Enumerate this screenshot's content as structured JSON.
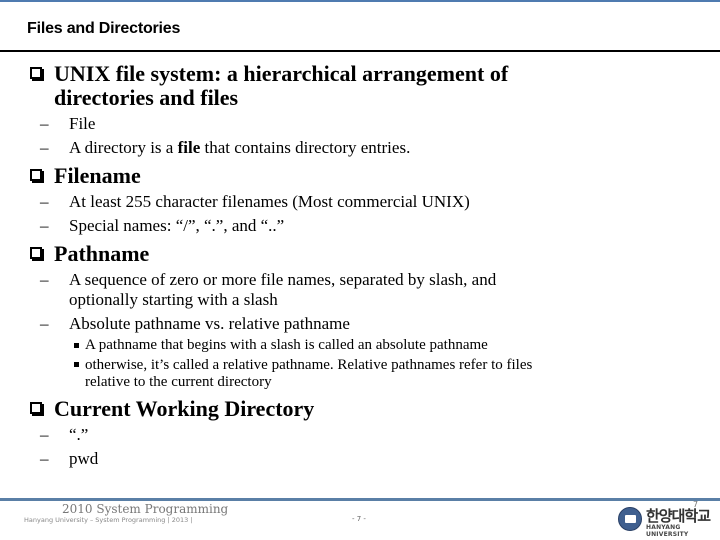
{
  "header": {
    "title": "Files and Directories",
    "accent_color": "#4f7bb0"
  },
  "sections": [
    {
      "heading": "UNIX file system: a hierarchical arrangement of directories and files",
      "heading_line1": "UNIX file system: a hierarchical arrangement of",
      "heading_line2": "directories and files",
      "items": [
        {
          "text": "File"
        },
        {
          "pre": "A directory is a ",
          "bold": "file",
          "post": " that contains directory entries."
        }
      ]
    },
    {
      "heading": "Filename",
      "items": [
        {
          "text": "At least 255 character filenames (Most commercial UNIX)"
        },
        {
          "text": "Special names: “/”, “.”, and “..”"
        }
      ]
    },
    {
      "heading": "Pathname",
      "items": [
        {
          "line1": "A sequence of zero or more file names, separated by slash, and",
          "line2": "optionally starting with a slash"
        },
        {
          "text": "Absolute pathname vs. relative pathname",
          "subitems": [
            {
              "text": "A pathname that begins with a slash is called an absolute pathname"
            },
            {
              "line1": "otherwise, it’s called a relative pathname. Relative pathnames refer to files",
              "line2": "relative to the current directory"
            }
          ]
        }
      ]
    },
    {
      "heading": "Current Working Directory",
      "items": [
        {
          "text": "“.”"
        },
        {
          "text": "pwd"
        }
      ]
    }
  ],
  "footer": {
    "course": "2010 System Programming",
    "subtitle": "Hanyang University – System Programming  | 2013 |",
    "page_center": "- 7 -",
    "page_right": "7",
    "logo_korean": "한양대학교",
    "logo_english": "HANYANG UNIVERSITY",
    "bar_color": "#5a7fa6"
  }
}
